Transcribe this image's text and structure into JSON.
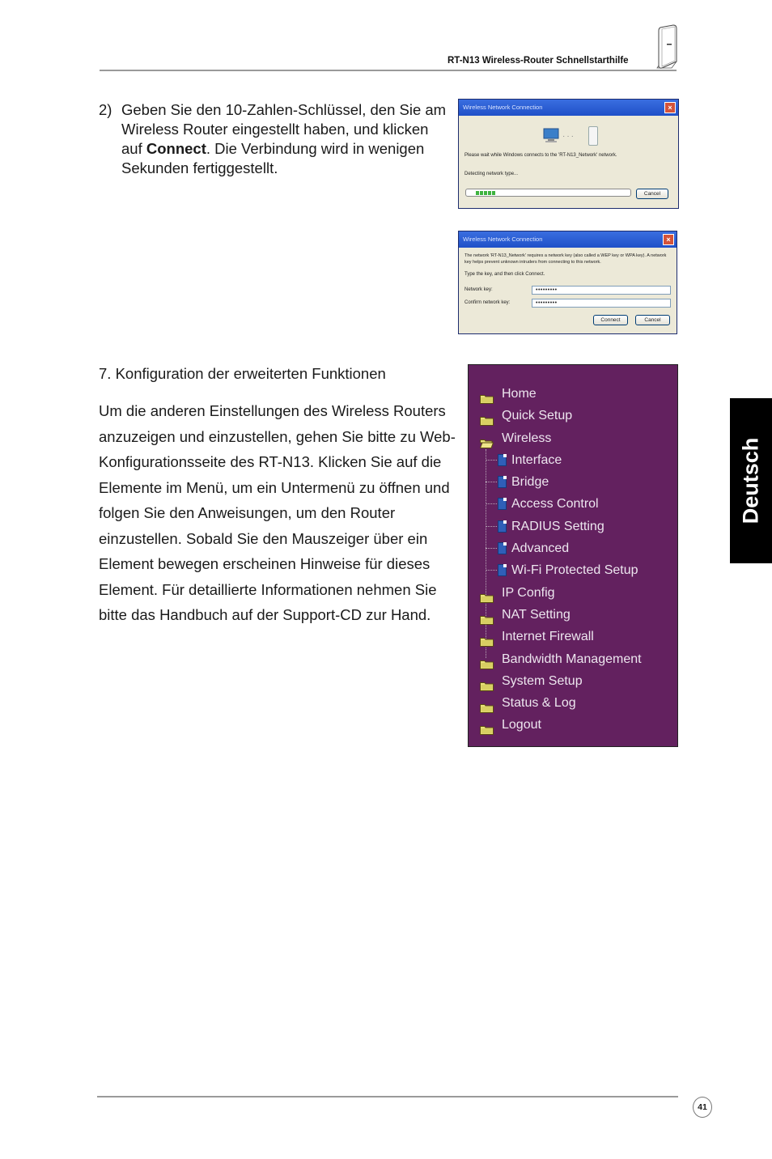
{
  "header": {
    "title": "RT-N13 Wireless-Router Schnellstarthilfe",
    "icon": "router-icon"
  },
  "step2": {
    "number": "2)",
    "text_before": "Geben Sie den 10-Zahlen-Schlüssel, den Sie am Wireless Router eingestellt haben, und klicken auf ",
    "bold": "Connect",
    "text_after": ". Die Verbindung wird in wenigen Sekunden fertiggestellt."
  },
  "dialog_connecting": {
    "title": "Wireless Network Connection",
    "message": "Please wait while Windows connects to the 'RT-N13_Network' network.",
    "status": "Detecting network type...",
    "progress_blocks": 5,
    "cancel_label": "Cancel"
  },
  "dialog_key": {
    "title": "Wireless Network Connection",
    "message": "The network 'RT-N13_Network' requires a network key (also called a WEP key or WPA key). A network key helps prevent unknown intruders from connecting to this network.",
    "instruction": "Type the key, and then click Connect.",
    "network_key_label": "Network key:",
    "network_key_value": "•••••••••",
    "confirm_key_label": "Confirm network key:",
    "confirm_key_value": "•••••••••",
    "connect_label": "Connect",
    "cancel_label": "Cancel"
  },
  "step7": {
    "heading": "7.  Konfiguration der erweiterten Funktionen",
    "paragraph": "Um die anderen Einstellungen des Wireless Routers  anzuzeigen und einzustellen, gehen Sie bitte zu Web-Konfigurationsseite des RT-N13. Klicken Sie auf die Elemente im Menü, um ein Untermenü zu öffnen und folgen Sie den Anweisungen, um den Router einzustellen. Sobald Sie den Mauszeiger über ein Element bewegen erscheinen Hinweise für dieses Element. Für detaillierte Informationen nehmen Sie bitte das Handbuch auf der Support-CD zur Hand."
  },
  "menu": {
    "background": "#63215f",
    "items": [
      {
        "label": "Home",
        "type": "folder"
      },
      {
        "label": "Quick Setup",
        "type": "folder"
      },
      {
        "label": "Wireless",
        "type": "folder-open"
      },
      {
        "label": "Interface",
        "type": "page"
      },
      {
        "label": "Bridge",
        "type": "page"
      },
      {
        "label": "Access Control",
        "type": "page"
      },
      {
        "label": "RADIUS Setting",
        "type": "page"
      },
      {
        "label": "Advanced",
        "type": "page"
      },
      {
        "label": "Wi-Fi Protected Setup",
        "type": "page"
      },
      {
        "label": "IP Config",
        "type": "folder"
      },
      {
        "label": "NAT Setting",
        "type": "folder"
      },
      {
        "label": "Internet Firewall",
        "type": "folder"
      },
      {
        "label": "Bandwidth Management",
        "type": "folder"
      },
      {
        "label": "System Setup",
        "type": "folder"
      },
      {
        "label": "Status & Log",
        "type": "folder"
      },
      {
        "label": "Logout",
        "type": "folder"
      }
    ]
  },
  "language_tab": "Deutsch",
  "footer": {
    "page_number": "41"
  }
}
